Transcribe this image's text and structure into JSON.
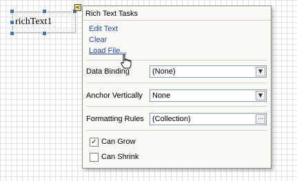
{
  "control": {
    "text": "richText1"
  },
  "smart_tag": {
    "glyph": "<"
  },
  "panel": {
    "title": "Rich Text Tasks",
    "actions": [
      "Edit Text",
      "Clear",
      "Load File..."
    ],
    "properties": [
      {
        "label": "Data Binding",
        "value": "(None)",
        "button": "dropdown"
      },
      {
        "label": "Anchor Vertically",
        "value": "None",
        "button": "dropdown"
      },
      {
        "label": "Formatting Rules",
        "value": "(Collection)",
        "button": "ellipsis"
      }
    ],
    "checkboxes": [
      {
        "label": "Can Grow",
        "checked": true
      },
      {
        "label": "Can Shrink",
        "checked": false
      }
    ]
  },
  "glyphs": {
    "dropdown": "▼",
    "ellipsis": "⋯",
    "check": "✓"
  }
}
